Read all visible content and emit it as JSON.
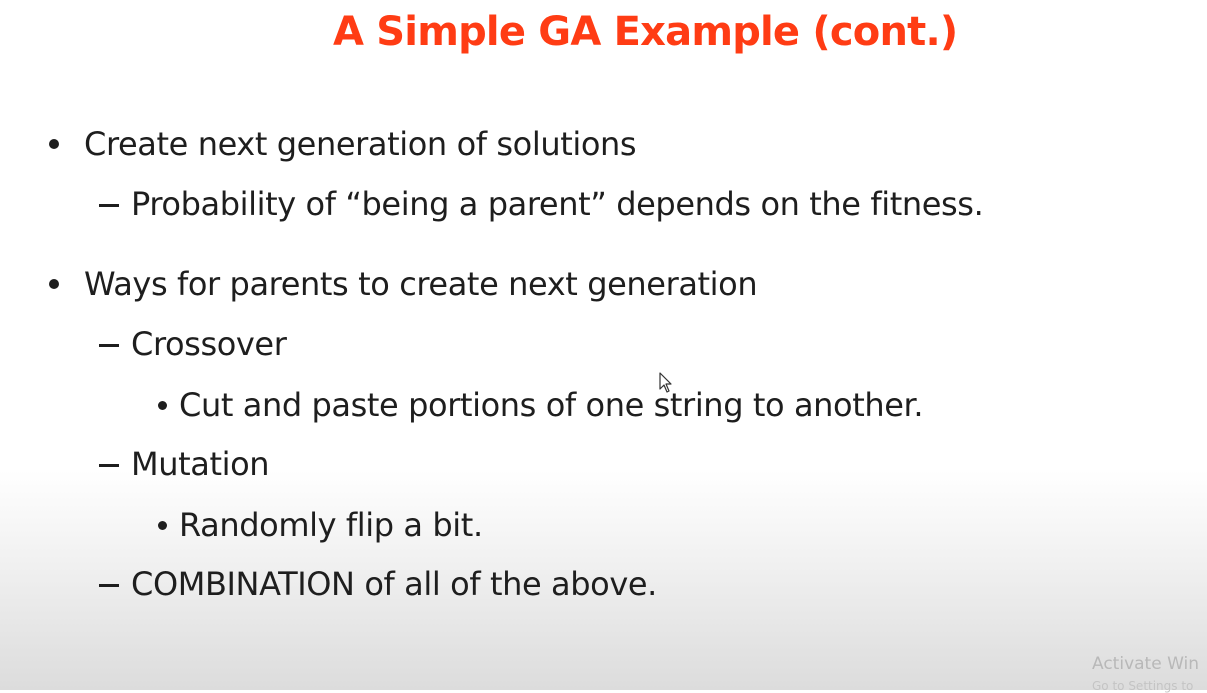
{
  "slide": {
    "title": "A Simple GA Example (cont.)",
    "items": [
      {
        "level": 1,
        "text": "Create next generation of solutions"
      },
      {
        "level": 2,
        "text": "Probability of “being a parent” depends on the fitness."
      },
      {
        "level": 1,
        "text": "Ways for parents to create next generation"
      },
      {
        "level": 2,
        "text": "Crossover"
      },
      {
        "level": 3,
        "text": "Cut and paste portions of one string to another."
      },
      {
        "level": 2,
        "text": "Mutation"
      },
      {
        "level": 3,
        "text": "Randomly flip a bit."
      },
      {
        "level": 2,
        "text": "COMBINATION of all of the above."
      }
    ]
  },
  "watermark": {
    "line1": "Activate Win",
    "line2": "Go to Settings to"
  },
  "colors": {
    "title": "#ff3c14",
    "text": "#1e1e1e"
  }
}
